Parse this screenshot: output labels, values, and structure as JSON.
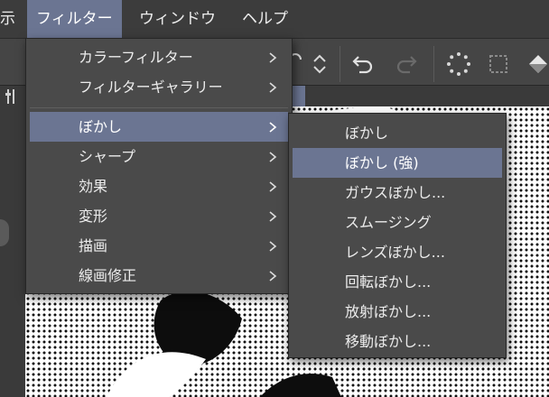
{
  "menubar": {
    "items": [
      {
        "label": "示"
      },
      {
        "label": "フィルター"
      },
      {
        "label": "ウィンドウ"
      },
      {
        "label": "ヘルプ"
      }
    ]
  },
  "filter_menu": {
    "items": [
      {
        "label": "カラーフィルター"
      },
      {
        "label": "フィルターギャラリー"
      },
      {
        "label": "ぼかし"
      },
      {
        "label": "シャープ"
      },
      {
        "label": "効果"
      },
      {
        "label": "変形"
      },
      {
        "label": "描画"
      },
      {
        "label": "線画修正"
      }
    ],
    "selected": "ぼかし"
  },
  "blur_submenu": {
    "items": [
      {
        "label": "ぼかし"
      },
      {
        "label": "ぼかし (強)"
      },
      {
        "label": "ガウスぼかし..."
      },
      {
        "label": "スムージング"
      },
      {
        "label": "レンズぼかし..."
      },
      {
        "label": "回転ぼかし..."
      },
      {
        "label": "放射ぼかし..."
      },
      {
        "label": "移動ぼかし..."
      }
    ],
    "highlighted": "ぼかし (強)"
  },
  "colors": {
    "menu_bg": "#4a4a4a",
    "highlight": "#6b7592",
    "menubar_bg": "#3c3c3c",
    "text": "#ececec"
  },
  "icons": [
    "chevron-up-down-icon",
    "undo-icon",
    "redo-icon",
    "busy-spinner-icon",
    "selection-dotted-icon",
    "fill-bucket-icon",
    "chevron-right-icon"
  ]
}
